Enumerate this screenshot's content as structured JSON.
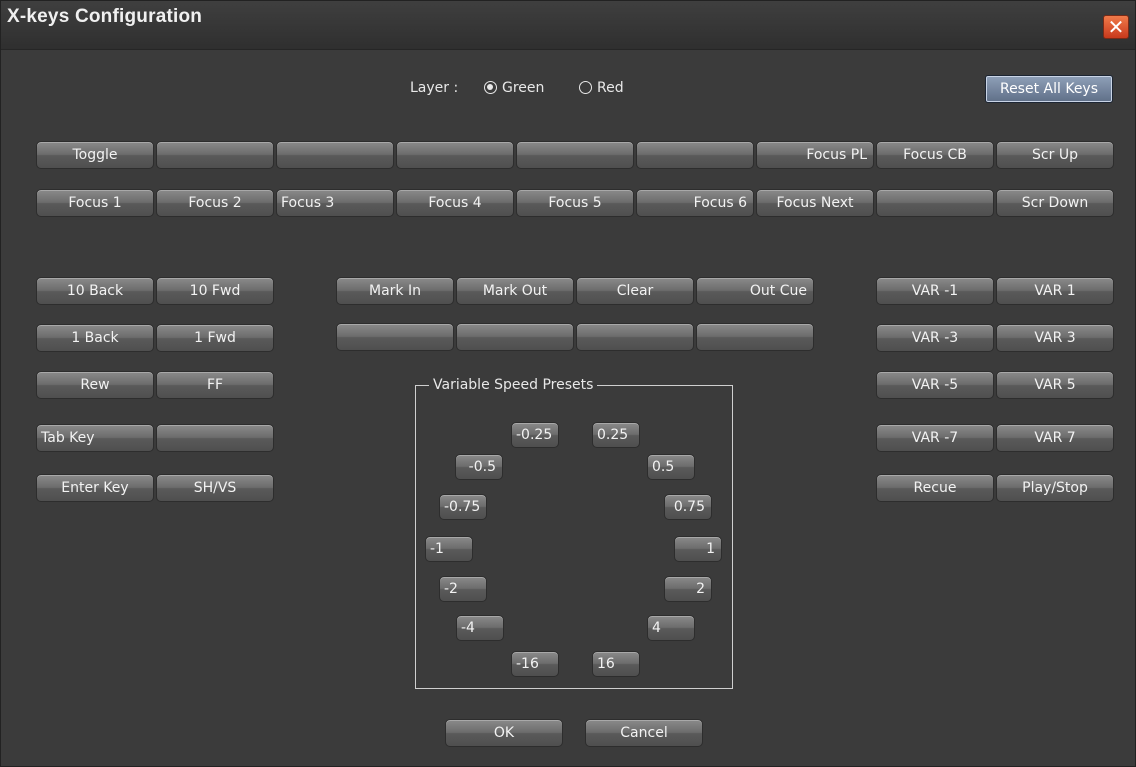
{
  "window": {
    "title": "X-keys Configuration"
  },
  "layer": {
    "label": "Layer :",
    "options": [
      "Green",
      "Red"
    ],
    "selected": "Green"
  },
  "reset_label": "Reset All Keys",
  "top_row1": [
    "Toggle",
    "",
    "",
    "",
    "",
    "",
    "Focus PL",
    "Focus CB",
    "Scr Up"
  ],
  "top_row2": [
    "Focus 1",
    "Focus 2",
    "Focus 3",
    "Focus 4",
    "Focus 5",
    "Focus 6",
    "Focus Next",
    "",
    "Scr Down"
  ],
  "left_keys": [
    [
      "10 Back",
      "10 Fwd"
    ],
    [
      "1 Back",
      "1 Fwd"
    ],
    [
      "Rew",
      "FF"
    ],
    [
      "Tab Key",
      ""
    ],
    [
      "Enter Key",
      "SH/VS"
    ]
  ],
  "mid_keys": [
    [
      "Mark In",
      "Mark Out",
      "Clear",
      "Out Cue"
    ],
    [
      "",
      "",
      "",
      ""
    ]
  ],
  "right_keys": [
    [
      "VAR -1",
      "VAR 1"
    ],
    [
      "VAR -3",
      "VAR 3"
    ],
    [
      "VAR -5",
      "VAR 5"
    ],
    [
      "VAR -7",
      "VAR 7"
    ],
    [
      "Recue",
      "Play/Stop"
    ]
  ],
  "presets": {
    "label": "Variable Speed Presets",
    "values": [
      "-0.25",
      "0.25",
      "-0.5",
      "0.5",
      "-0.75",
      "0.75",
      "-1",
      "1",
      "-2",
      "2",
      "-4",
      "4",
      "-16",
      "16"
    ]
  },
  "footer": {
    "ok": "OK",
    "cancel": "Cancel"
  },
  "colors": {
    "background": "#3b3b3b",
    "button": "#6c6c6c",
    "reset_button": "#6f7f98",
    "close_button": "#d9471f"
  }
}
